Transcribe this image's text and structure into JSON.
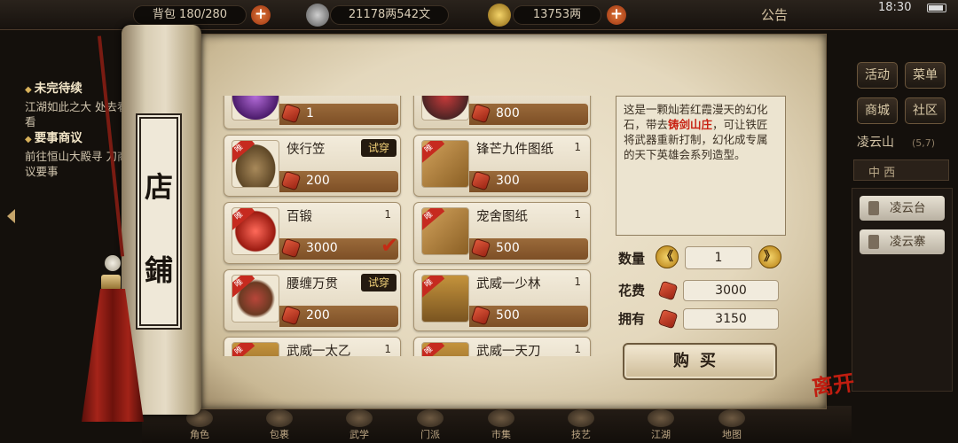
{
  "topbar": {
    "bag": "背包 180/280",
    "silver": "21178两542文",
    "gold": "13753两",
    "notice": "公告",
    "time": "18:30",
    "plus": "+"
  },
  "quest": {
    "h1": "未完待续",
    "t1": "江湖如此之大 处去看看",
    "h2": "要事商议",
    "t2": "前往恒山大殿寻 刀商议要事"
  },
  "sidemenu": {
    "activity": "活动",
    "menu": "菜单",
    "mall": "商城",
    "community": "社区",
    "location": "凌云山",
    "coord": "(5,7)",
    "mini": "中 西",
    "loc1": "凌云台",
    "loc2": "凌云寨"
  },
  "shop": {
    "title_1": "店",
    "title_2": "鋪",
    "unique_tag": "唯",
    "try_label": "试穿",
    "items": [
      {
        "name": "",
        "qty": "",
        "price": "1",
        "tag": false,
        "try": false
      },
      {
        "name": "",
        "qty": "",
        "price": "800",
        "tag": false,
        "try": false
      },
      {
        "name": "侠行笠",
        "qty": "",
        "price": "200",
        "tag": true,
        "try": true
      },
      {
        "name": "锋芒九件图纸",
        "qty": "1",
        "price": "300",
        "tag": true,
        "try": false
      },
      {
        "name": "百锻",
        "qty": "1",
        "price": "3000",
        "tag": true,
        "try": false,
        "selected": true
      },
      {
        "name": "宠舍图纸",
        "qty": "1",
        "price": "500",
        "tag": true,
        "try": false
      },
      {
        "name": "腰缠万贯",
        "qty": "",
        "price": "200",
        "tag": true,
        "try": true
      },
      {
        "name": "武威一少林",
        "qty": "1",
        "price": "500",
        "tag": true,
        "try": false
      },
      {
        "name": "武威一太乙",
        "qty": "1",
        "price": "",
        "tag": true,
        "try": false
      },
      {
        "name": "武威一天刀",
        "qty": "1",
        "price": "",
        "tag": true,
        "try": false
      }
    ]
  },
  "detail": {
    "desc_1": "这是一颗灿若红霞漫天的幻化石，带去",
    "desc_hl": "铸剑山庄",
    "desc_2": "，可让铁匠将武器重新打制，幻化成专属的天下英雄会系列造型。",
    "qty_label": "数量",
    "qty_value": "1",
    "cost_label": "花费",
    "cost_value": "3000",
    "own_label": "拥有",
    "own_value": "3150",
    "buy_label": "购买",
    "close_label": "离开",
    "minus": "《",
    "plus": "》"
  },
  "bottom": [
    "角色",
    "包裹",
    "武学",
    "门派",
    "市集",
    "技艺",
    "江湖",
    "地图"
  ],
  "colors": {
    "accent": "#c42b15",
    "paper": "#e4d8bd",
    "price_bar": "#8a5a2e"
  }
}
